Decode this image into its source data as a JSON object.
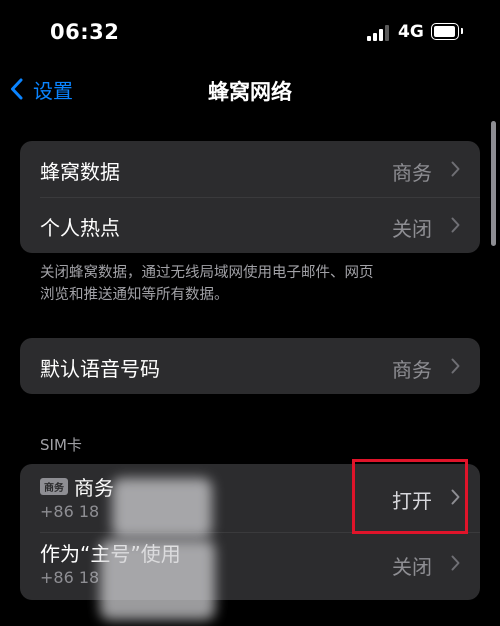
{
  "status_bar": {
    "time": "06:32",
    "network": "4G"
  },
  "nav": {
    "back_label": "设置",
    "title": "蜂窝网络"
  },
  "group1": {
    "rows": [
      {
        "label": "蜂窝数据",
        "value": "商务"
      },
      {
        "label": "个人热点",
        "value": "关闭"
      }
    ]
  },
  "footnote_line1": "关闭蜂窝数据，通过无线局域网使用电子邮件、网页",
  "footnote_line2": "浏览和推送通知等所有数据。",
  "group2": {
    "label": "默认语音号码",
    "value": "商务"
  },
  "sim_section": {
    "header": "SIM卡",
    "rows": [
      {
        "badge": "商务",
        "label": "商务",
        "sub": "+86 18",
        "value": "打开"
      },
      {
        "label": "作为“主号”使用",
        "sub": "+86 18",
        "value": "关闭"
      }
    ]
  },
  "colors": {
    "accent": "#0a84ff",
    "highlight": "#e0142a",
    "cell_bg": "#2c2c2e"
  }
}
